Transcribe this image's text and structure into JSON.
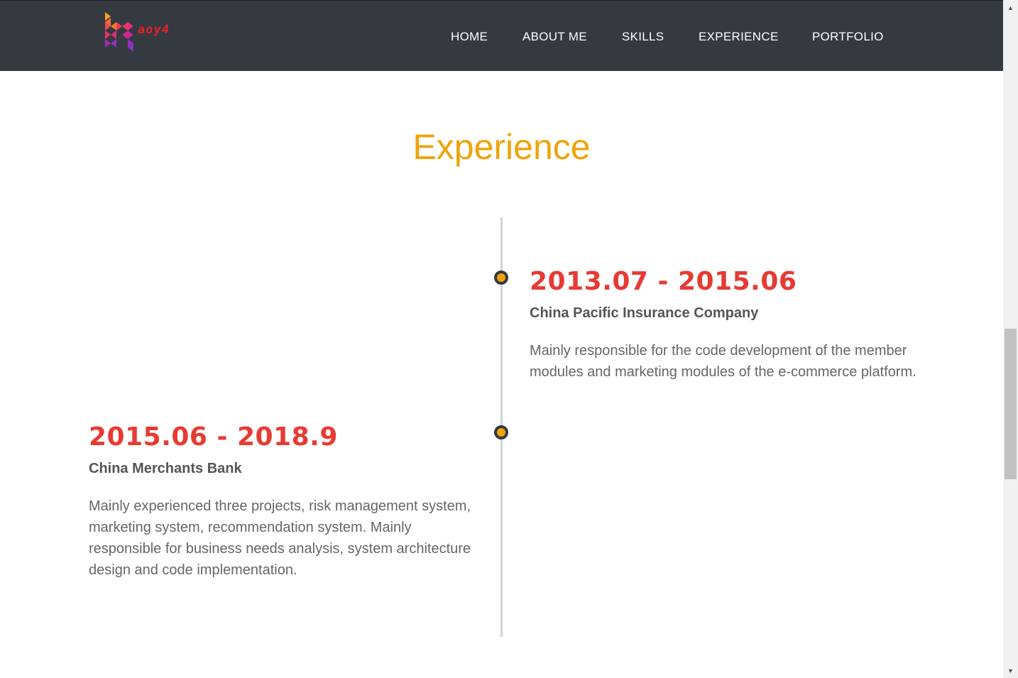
{
  "header": {
    "logo_text": "aoy4",
    "nav": {
      "home": "HOME",
      "about": "ABOUT ME",
      "skills": "SKILLS",
      "experience": "EXPERIENCE",
      "portfolio": "PORTFOLIO"
    }
  },
  "section": {
    "title": "Experience"
  },
  "timeline": {
    "entries": [
      {
        "date": "2013.07 - 2015.06",
        "company": "China Pacific Insurance Company",
        "description": "Mainly responsible for the code development of the member modules and marketing modules of the e-commerce platform."
      },
      {
        "date": "2015.06 - 2018.9",
        "company": "China Merchants Bank",
        "description": "Mainly experienced three projects, risk management system, marketing system, recommendation system. Mainly responsible for business needs analysis, system architecture design and code implementation."
      }
    ]
  },
  "colors": {
    "navbar": "#343a40",
    "title": "#f0a30a",
    "date": "#e63b33",
    "dot": "#f0a30a"
  },
  "icons": {
    "logo": "hexagon-logo-icon",
    "scroll_up": "scroll-up-arrow-icon",
    "scroll_down": "scroll-down-arrow-icon"
  }
}
